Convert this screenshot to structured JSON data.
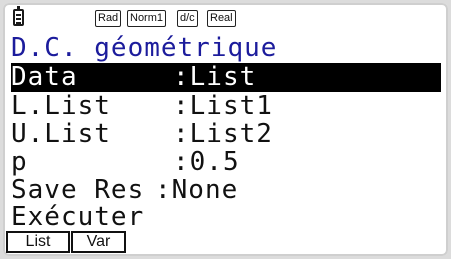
{
  "status_bar": {
    "angle": "Rad",
    "display": "Norm1",
    "fraction": "d/c",
    "complex": "Real"
  },
  "screen": {
    "title": "D.C. géométrique",
    "rows": [
      {
        "label": "Data",
        "sep": ":",
        "value": "List"
      },
      {
        "label": "L.List",
        "sep": ":",
        "value": "List1"
      },
      {
        "label": "U.List",
        "sep": ":",
        "value": "List2"
      },
      {
        "label": "p",
        "sep": ":",
        "value": "0.5"
      },
      {
        "label": "Save Res",
        "sep": ":",
        "value": "None"
      }
    ],
    "execute": "Exécuter"
  },
  "function_keys": {
    "f1": "List",
    "f2": "Var"
  }
}
